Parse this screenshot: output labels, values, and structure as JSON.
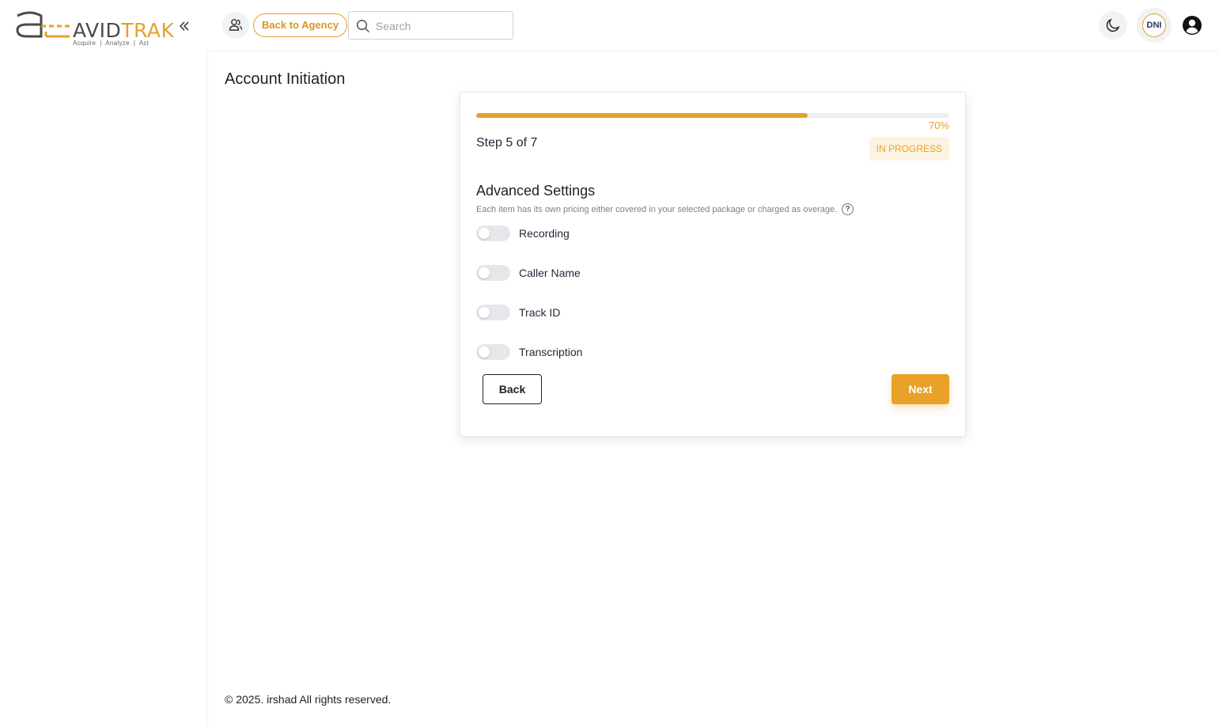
{
  "brand": {
    "name_part1": "AVID",
    "name_part2": "TRAK",
    "tagline": "Acquire  |  Analyze  |  Act",
    "accent_color": "#e6a12a"
  },
  "header": {
    "back_to_agency_label": "Back to Agency",
    "search_placeholder": "Search",
    "dni_label": "DNI",
    "icons": [
      "users-icon",
      "search-icon",
      "moon-icon",
      "user-circle-icon",
      "chevrons-left-icon"
    ]
  },
  "page": {
    "title": "Account Initiation"
  },
  "wizard": {
    "progress_percent": 70,
    "progress_text": "70%",
    "step_text": "Step 5 of 7",
    "status": "IN PROGRESS",
    "section_title": "Advanced Settings",
    "section_desc": "Each item has its own pricing either covered in your selected package or charged as overage.",
    "toggles": [
      {
        "label": "Recording",
        "on": false
      },
      {
        "label": "Caller Name",
        "on": false
      },
      {
        "label": "Track ID",
        "on": false
      },
      {
        "label": "Transcription",
        "on": false
      }
    ],
    "back_label": "Back",
    "next_label": "Next"
  },
  "footer": {
    "text": "© 2025. irshad All rights reserved."
  }
}
